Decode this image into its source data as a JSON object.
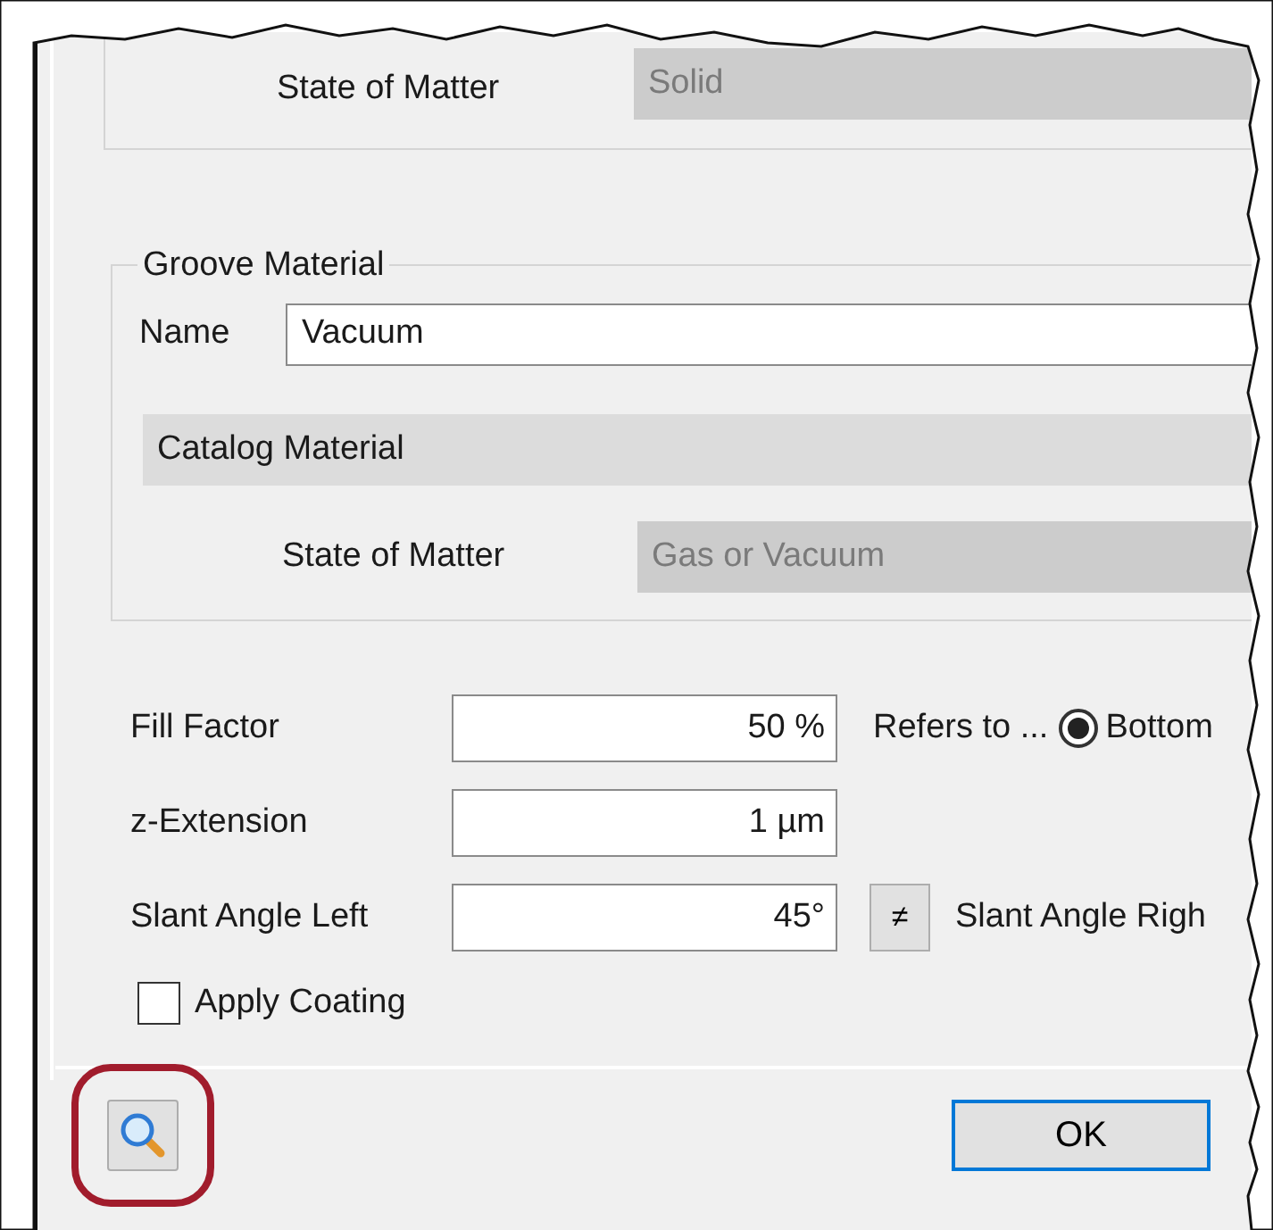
{
  "top_group": {
    "state_label": "State of Matter",
    "state_value": "Solid",
    "disabled": true
  },
  "groove_material": {
    "title": "Groove Material",
    "name_label": "Name",
    "name_value": "Vacuum",
    "catalog": "Catalog Material",
    "state_label": "State of Matter",
    "state_value": "Gas or Vacuum",
    "disabled": true
  },
  "fields": [
    {
      "label": "Fill Factor",
      "value": "50 %"
    },
    {
      "label": "z-Extension",
      "value": "1 µm"
    },
    {
      "label": "Slant Angle Left",
      "value": "45°"
    }
  ],
  "refers_to": {
    "label": "Refers to ...",
    "option": "Bottom",
    "selected": true
  },
  "asymmetry_button": "≠",
  "slant_right_label": "Slant Angle Righ",
  "apply_coating": {
    "label": "Apply Coating",
    "checked": false
  },
  "search_button": {
    "highlighted": true
  },
  "buttons": [
    {
      "label": "OK",
      "default": true
    }
  ]
}
